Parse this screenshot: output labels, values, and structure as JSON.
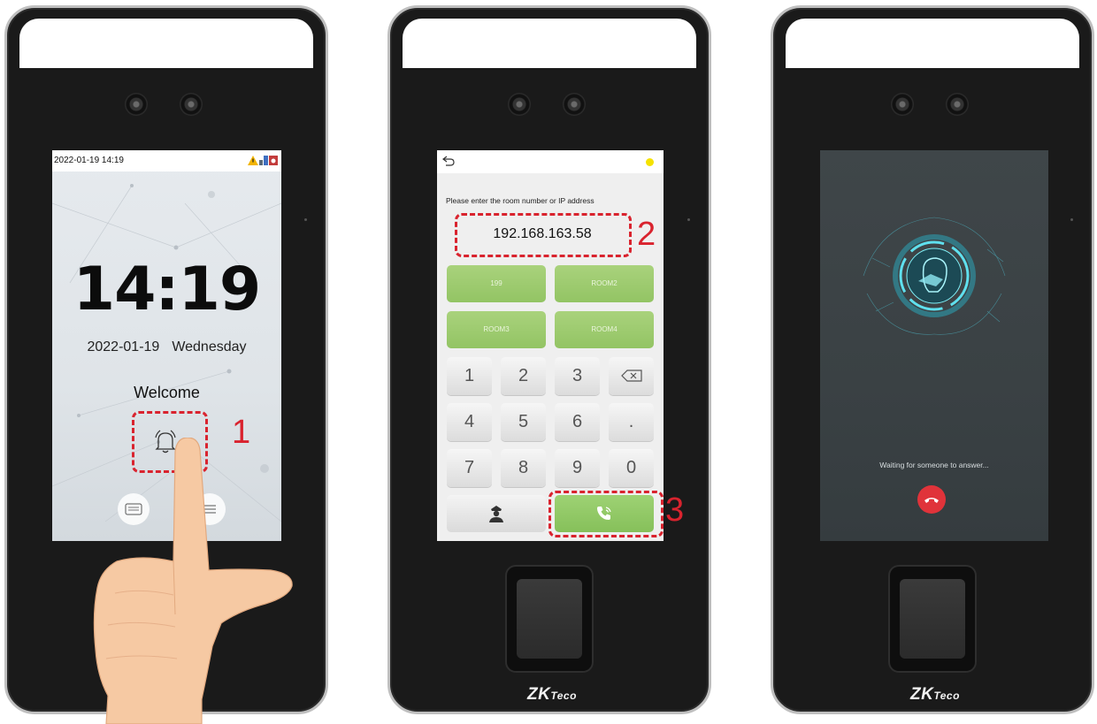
{
  "device_home": {
    "status_time": "2022-01-19 14:19",
    "clock": "14:19",
    "date": "2022-01-19",
    "weekday": "Wednesday",
    "welcome": "Welcome",
    "annotation": "1"
  },
  "device_dial": {
    "prompt": "Please enter the room number or IP address",
    "ip_value": "192.168.163.58",
    "annotation_ip": "2",
    "rooms": [
      "199",
      "ROOM2",
      "ROOM3",
      "ROOM4"
    ],
    "keys": [
      "1",
      "2",
      "3",
      "4",
      "5",
      "6",
      ".",
      "7",
      "8",
      "9",
      "0"
    ],
    "annotation_call": "3",
    "brand": "ZK",
    "brand_suffix": "Teco"
  },
  "device_call": {
    "waiting_text": "Waiting for someone to answer...",
    "brand": "ZK",
    "brand_suffix": "Teco"
  },
  "colors": {
    "annotation": "#d9232e",
    "room_button": "#9ccb6e",
    "call_button": "#8cc464",
    "hangup": "#e0333a",
    "status_dot": "#f5e200"
  },
  "icons": [
    "bell-icon",
    "keyboard-icon",
    "menu-icon",
    "back-icon",
    "backspace-icon",
    "security-guard-icon",
    "phone-call-icon",
    "face-scan-icon",
    "hang-up-icon",
    "warning-icon"
  ]
}
